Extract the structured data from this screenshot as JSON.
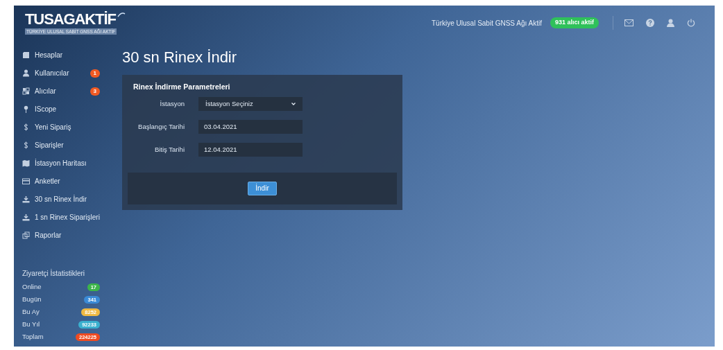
{
  "header": {
    "logo_title": "TUSAGAKTİF",
    "logo_subtitle": "TÜRKİYE ULUSAL SABİT GNSS AĞI AKTİF",
    "status_text": "Türkiye Ulusal Sabit GNSS Ağı Aktif",
    "status_badge": "931 alıcı aktif"
  },
  "sidebar": {
    "items": [
      {
        "label": "Hesaplar"
      },
      {
        "label": "Kullanıcılar",
        "badge": "1"
      },
      {
        "label": "Alıcılar",
        "badge": "3"
      },
      {
        "label": "IScope"
      },
      {
        "label": "Yeni Sipariş"
      },
      {
        "label": "Siparişler"
      },
      {
        "label": "İstasyon Haritası"
      },
      {
        "label": "Anketler"
      },
      {
        "label": "30 sn Rinex İndir"
      },
      {
        "label": "1 sn Rinex Siparişleri"
      },
      {
        "label": "Raporlar"
      }
    ],
    "stats_title": "Ziyaretçi İstatistikleri",
    "stats": [
      {
        "label": "Online",
        "value": "17",
        "color": "#3cb54a"
      },
      {
        "label": "Bugün",
        "value": "341",
        "color": "#3a8ad6"
      },
      {
        "label": "Bu Ay",
        "value": "8252",
        "color": "#efb943"
      },
      {
        "label": "Bu Yıl",
        "value": "92233",
        "color": "#3ab0cf"
      },
      {
        "label": "Toplam",
        "value": "224225",
        "color": "#ee4b22"
      }
    ]
  },
  "page_title": "30 sn Rinex İndir",
  "form": {
    "title": "Rinex İndirme Parametreleri",
    "fields": [
      {
        "kind": "select",
        "label": "İstasyon",
        "placeholder": "İstasyon Seçiniz"
      },
      {
        "kind": "text",
        "label": "Başlangıç Tarihi",
        "value": "03.04.2021"
      },
      {
        "kind": "text",
        "label": "Bitiş Tarihi",
        "value": "12.04.2021"
      }
    ],
    "submit": "İndir"
  }
}
